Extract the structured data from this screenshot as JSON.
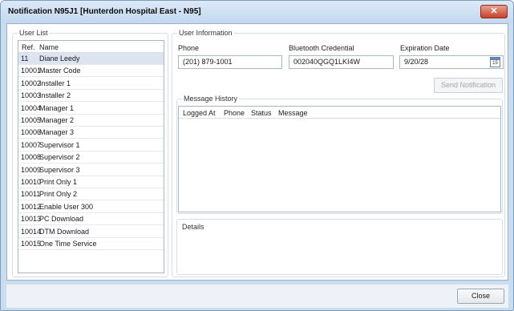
{
  "window": {
    "title": "Notification N95J1 [Hunterdon Hospital East - N95]",
    "close_glyph": "✕"
  },
  "user_list": {
    "group_label": "User List",
    "columns": [
      "Ref.",
      "Name"
    ],
    "rows": [
      {
        "ref": "11",
        "name": "Diane Leedy"
      },
      {
        "ref": "10001",
        "name": "Master Code"
      },
      {
        "ref": "10002",
        "name": "Installer 1"
      },
      {
        "ref": "10003",
        "name": "Installer 2"
      },
      {
        "ref": "10004",
        "name": "Manager 1"
      },
      {
        "ref": "10005",
        "name": "Manager 2"
      },
      {
        "ref": "10006",
        "name": "Manager 3"
      },
      {
        "ref": "10007",
        "name": "Supervisor 1"
      },
      {
        "ref": "10008",
        "name": "Supervisor 2"
      },
      {
        "ref": "10009",
        "name": "Supervisor 3"
      },
      {
        "ref": "10010",
        "name": "Print Only 1"
      },
      {
        "ref": "10011",
        "name": "Print Only 2"
      },
      {
        "ref": "10012",
        "name": "Enable User 300"
      },
      {
        "ref": "10013",
        "name": "PC Download"
      },
      {
        "ref": "10014",
        "name": "DTM Download"
      },
      {
        "ref": "10015",
        "name": "One Time Service"
      }
    ],
    "selected_index": 0
  },
  "user_info": {
    "group_label": "User Information",
    "phone_label": "Phone",
    "phone_value": "(201) 879-1001",
    "bluetooth_label": "Bluetooth Credential",
    "bluetooth_value": "002040QGQ1LKI4W",
    "expiration_label": "Expiration Date",
    "expiration_value": "9/20/28",
    "calendar_day": "15",
    "send_button": "Send Notification"
  },
  "message_history": {
    "group_label": "Message History",
    "columns": [
      "Logged At",
      "Phone",
      "Status",
      "Message"
    ]
  },
  "details": {
    "group_label": "Details"
  },
  "footer": {
    "close_button": "Close"
  },
  "colors": {
    "accent": "#5f86b6",
    "selected_row": "#dbe4ef",
    "title_close": "#c5422b"
  }
}
